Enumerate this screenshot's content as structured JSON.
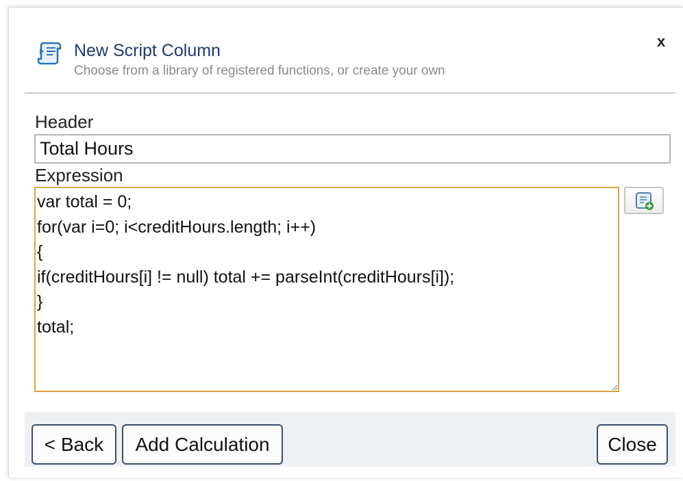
{
  "dialog": {
    "title": "New Script Column",
    "subtitle": "Choose from a library of registered functions, or create your own",
    "close_label": "x",
    "title_icon": "script-icon"
  },
  "form": {
    "header_label": "Header",
    "header_value": "Total Hours",
    "expression_label": "Expression",
    "expression_value": "var total = 0;\nfor(var i=0; i<creditHours.length; i++)\n{\nif(creditHours[i] != null) total += parseInt(creditHours[i]);\n}\ntotal;",
    "library_button_icon": "script-add-icon"
  },
  "footer": {
    "back_label": "< Back",
    "add_calculation_label": "Add Calculation",
    "close_label": "Close"
  },
  "colors": {
    "title": "#1f3a6e",
    "subtitle": "#8a8a8a",
    "expression_border": "#d9a640",
    "button_border": "#3a4f6e",
    "footer_background": "#eef0f2"
  }
}
